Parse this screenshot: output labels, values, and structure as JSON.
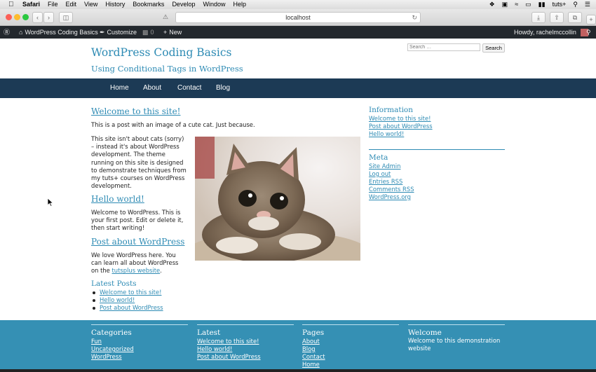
{
  "macos": {
    "menus": [
      "Safari",
      "File",
      "Edit",
      "View",
      "History",
      "Bookmarks",
      "Develop",
      "Window",
      "Help"
    ],
    "user": "tuts+"
  },
  "browser": {
    "url": "localhost"
  },
  "admin_bar": {
    "site_name": "WordPress Coding Basics",
    "customize": "Customize",
    "comments_count": "0",
    "new": "New",
    "howdy": "Howdy, rachelmccollin"
  },
  "site": {
    "title": "WordPress Coding Basics",
    "description": "Using Conditional Tags in WordPress",
    "search_placeholder": "Search …",
    "search_button": "Search"
  },
  "nav": [
    "Home",
    "About",
    "Contact",
    "Blog"
  ],
  "posts": [
    {
      "title": "Welcome to this site!",
      "intro": "This is a post with an image of a cute cat. Just because.",
      "body": [
        "This site isn't about cats (sorry)",
        "– instead it's about WordPress",
        "development. The theme",
        "running on this site is designed",
        "to demonstrate techniques from",
        "my tuts+ courses on WordPress",
        "development."
      ]
    },
    {
      "title": "Hello world!",
      "body": [
        "Welcome to WordPress. This is",
        "your first post. Edit or delete it,",
        "then start writing!"
      ]
    },
    {
      "title": "Post about WordPress",
      "body_before": "We love WordPress here. You",
      "body_line2": "can learn all about WordPress",
      "body_on": "on the",
      "link": "tutsplus website",
      "body_end": "."
    }
  ],
  "latest_posts": {
    "title": "Latest Posts",
    "items": [
      "Welcome to this site!",
      "Hello world!",
      "Post about WordPress"
    ]
  },
  "sidebar": {
    "information": {
      "title": "Information",
      "items": [
        "Welcome to this site!",
        "Post about WordPress",
        "Hello world!"
      ]
    },
    "meta": {
      "title": "Meta",
      "items": [
        "Site Admin",
        "Log out",
        "Entries RSS",
        "Comments RSS",
        "WordPress.org"
      ]
    }
  },
  "footer": {
    "categories": {
      "title": "Categories",
      "items": [
        "Fun",
        "Uncategorized",
        "WordPress"
      ]
    },
    "latest": {
      "title": "Latest",
      "items": [
        "Welcome to this site!",
        "Hello world!",
        "Post about WordPress"
      ]
    },
    "pages": {
      "title": "Pages",
      "items": [
        "About",
        "Blog",
        "Contact",
        "Home"
      ]
    },
    "welcome": {
      "title": "Welcome",
      "text_line1": "Welcome to this demonstration",
      "text_line2": "website"
    }
  }
}
